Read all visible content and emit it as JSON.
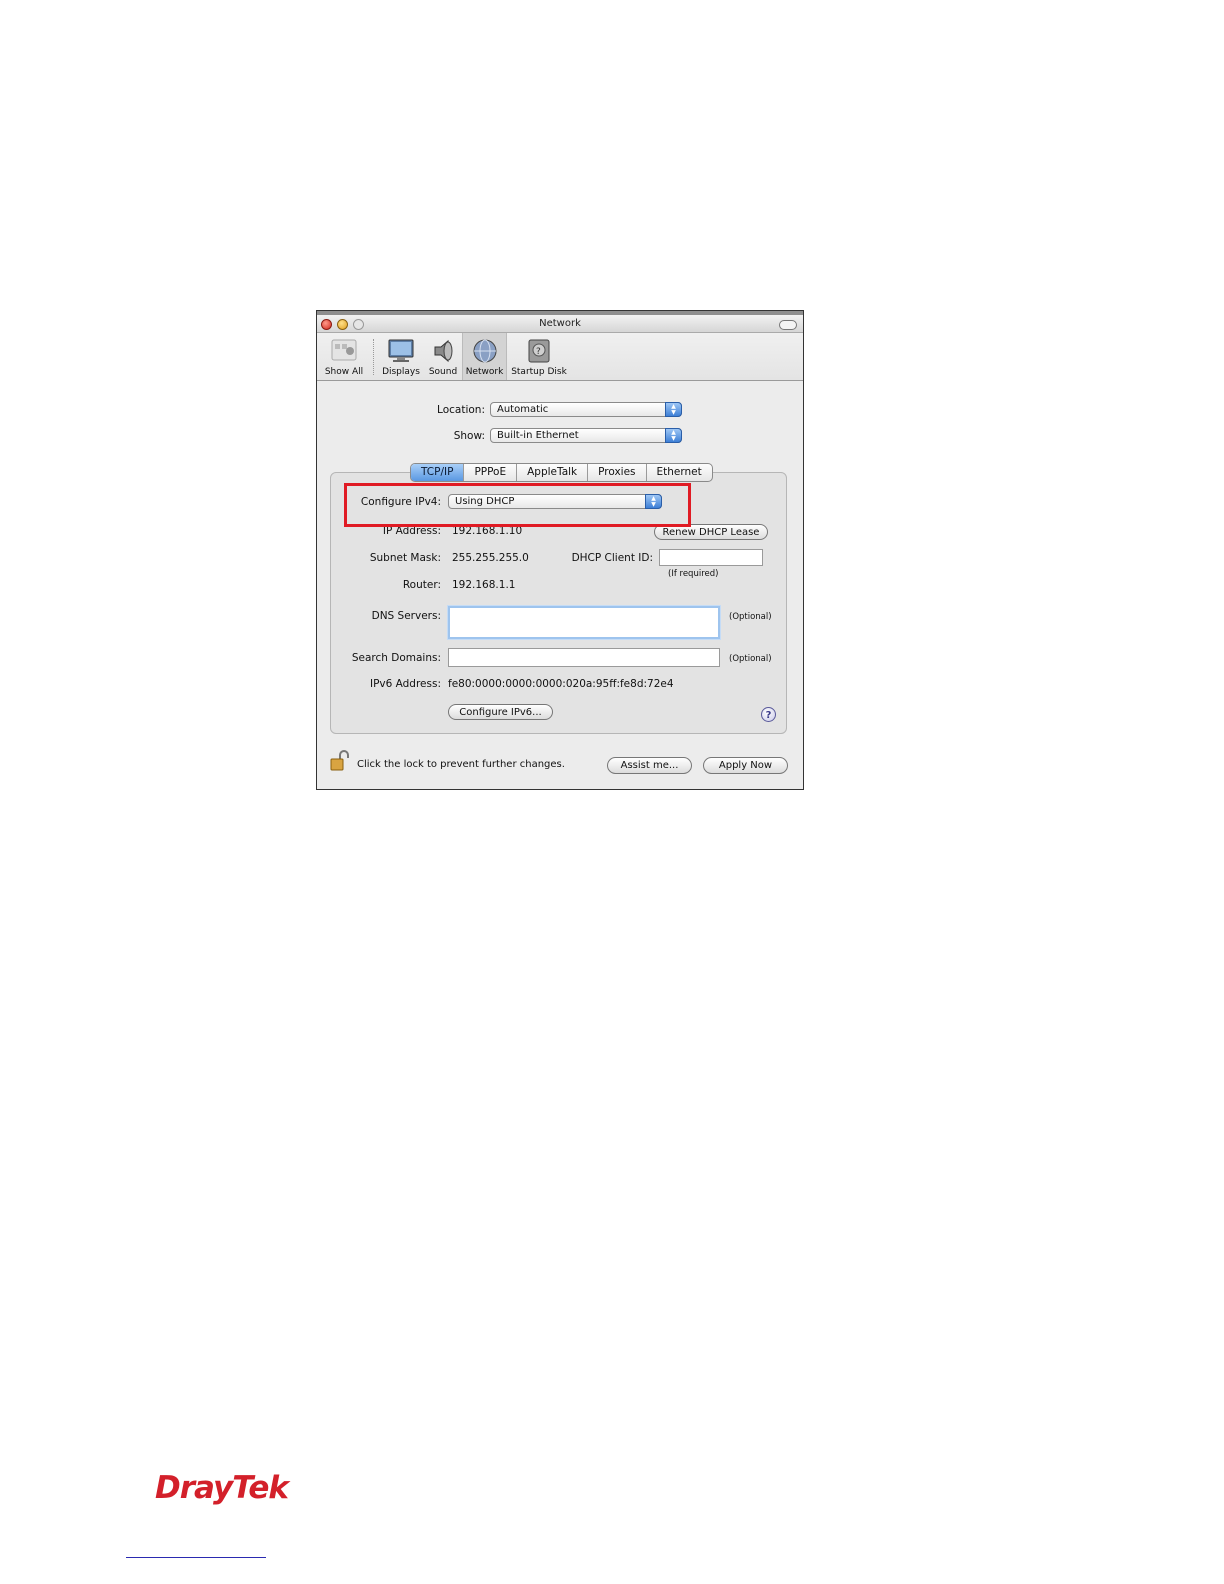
{
  "window": {
    "title": "Network"
  },
  "toolbar": {
    "items": [
      {
        "label": "Show All",
        "icon": "apple-grid-icon"
      },
      {
        "label": "Displays",
        "icon": "monitor-icon"
      },
      {
        "label": "Sound",
        "icon": "speaker-icon"
      },
      {
        "label": "Network",
        "icon": "globe-icon"
      },
      {
        "label": "Startup Disk",
        "icon": "hard-disk-icon"
      }
    ]
  },
  "location": {
    "label": "Location:",
    "value": "Automatic"
  },
  "show": {
    "label": "Show:",
    "value": "Built-in Ethernet"
  },
  "tabs": [
    "TCP/IP",
    "PPPoE",
    "AppleTalk",
    "Proxies",
    "Ethernet"
  ],
  "active_tab": "TCP/IP",
  "tcpip": {
    "configure_label": "Configure IPv4:",
    "configure_value": "Using DHCP",
    "ip_label": "IP Address:",
    "ip_value": "192.168.1.10",
    "renew_button": "Renew DHCP Lease",
    "subnet_label": "Subnet Mask:",
    "subnet_value": "255.255.255.0",
    "client_id_label": "DHCP Client ID:",
    "client_id_value": "",
    "client_id_hint": "(If required)",
    "router_label": "Router:",
    "router_value": "192.168.1.1",
    "dns_label": "DNS Servers:",
    "dns_value": "",
    "dns_hint": "(Optional)",
    "search_label": "Search Domains:",
    "search_value": "",
    "search_hint": "(Optional)",
    "ipv6_label": "IPv6 Address:",
    "ipv6_value": "fe80:0000:0000:0000:020a:95ff:fe8d:72e4",
    "configure_ipv6_button": "Configure IPv6...",
    "help_glyph": "?"
  },
  "bottom": {
    "lock_text": "Click the lock to prevent further changes.",
    "assist_button": "Assist me...",
    "apply_button": "Apply Now"
  },
  "footer": {
    "logo_text": "DrayTek"
  },
  "colors": {
    "highlight": "#e01b24",
    "logo": "#d3202a",
    "popup_accent": "#3d7fd6"
  }
}
